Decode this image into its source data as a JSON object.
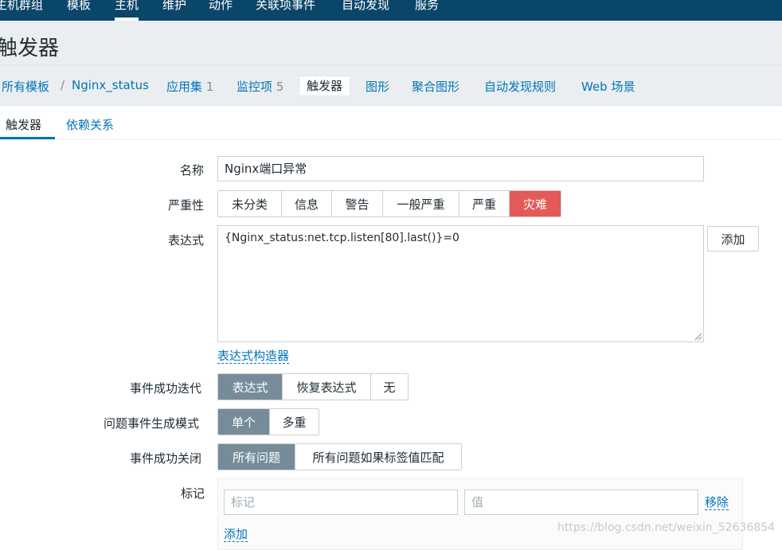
{
  "topnav": {
    "items": [
      {
        "label": "主机群组"
      },
      {
        "label": "模板"
      },
      {
        "label": "主机"
      },
      {
        "label": "维护"
      },
      {
        "label": "动作"
      },
      {
        "label": "关联项事件"
      },
      {
        "label": "自动发现"
      },
      {
        "label": "服务"
      }
    ],
    "active": "主机"
  },
  "header": {
    "title": "触发器"
  },
  "breadcrumb": {
    "all_templates": "所有模板",
    "separator": "/",
    "template": "Nginx_status",
    "applications": "应用集",
    "applications_count": "1",
    "items": "监控项",
    "items_count": "5",
    "triggers": "触发器",
    "graphs": "图形",
    "screens": "聚合图形",
    "discovery": "自动发现规则",
    "web": "Web 场景"
  },
  "subtabs": {
    "trigger": "触发器",
    "dependencies": "依赖关系"
  },
  "form": {
    "name_label": "名称",
    "name_value": "Nginx端口异常",
    "severity_label": "严重性",
    "severity_options": [
      "未分类",
      "信息",
      "警告",
      "一般严重",
      "严重",
      "灾难"
    ],
    "severity_selected": "灾难",
    "expression_label": "表达式",
    "expression_value": "{Nginx_status:net.tcp.listen[80].last()}=0",
    "add_button": "添加",
    "expression_constructor": "表达式构造器",
    "ok_event_label": "事件成功迭代",
    "ok_event_options": [
      "表达式",
      "恢复表达式",
      "无"
    ],
    "ok_event_selected": "表达式",
    "problem_mode_label": "问题事件生成模式",
    "problem_mode_options": [
      "单个",
      "多重"
    ],
    "problem_mode_selected": "单个",
    "ok_close_label": "事件成功关闭",
    "ok_close_options": [
      "所有问题",
      "所有问题如果标签值匹配"
    ],
    "ok_close_selected": "所有问题",
    "tags_label": "标记",
    "tag_placeholder": "标记",
    "value_placeholder": "值",
    "remove_link": "移除",
    "add_link": "添加"
  },
  "watermark": "https://blog.csdn.net/weixin_52636854",
  "colors": {
    "topnav_bg": "#0a466a",
    "link": "#0275b8",
    "selected_segment": "#768d99",
    "disaster": "#e45959"
  }
}
